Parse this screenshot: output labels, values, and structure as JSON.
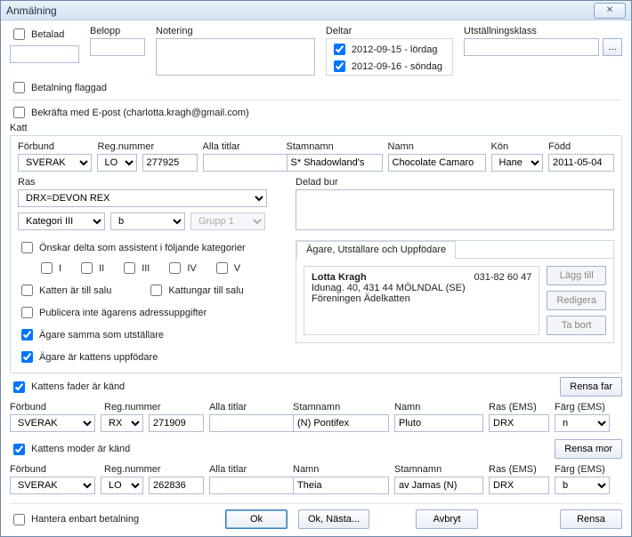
{
  "window": {
    "title": "Anmälning"
  },
  "top": {
    "betalad_label": "Betalad",
    "belopp_label": "Belopp",
    "notering_label": "Notering",
    "deltar_label": "Deltar",
    "utstallningsklass_label": "Utställningsklass",
    "betalning_flaggad_label": "Betalning flaggad",
    "deltar_items": [
      {
        "label": "2012-09-15 - lördag"
      },
      {
        "label": "2012-09-16 - söndag"
      }
    ],
    "utstallningsklass_value": ""
  },
  "confirm": {
    "label": "Bekräfta med E-post (charlotta.kragh@gmail.com)"
  },
  "katt": {
    "legend": "Katt",
    "forbund_label": "Förbund",
    "forbund_value": "SVERAK",
    "regprefix_value": "LO",
    "regnummer_label": "Reg.nummer",
    "regnummer_value": "277925",
    "alla_titlar_label": "Alla titlar",
    "alla_titlar_value": "",
    "stamnamn_label": "Stamnamn",
    "stamnamn_value": "S* Shadowland's",
    "namn_label": "Namn",
    "namn_value": "Chocolate Camaro",
    "kon_label": "Kön",
    "kon_value": "Hane",
    "fodd_label": "Född",
    "fodd_value": "2011-05-04",
    "ras_label": "Ras",
    "ras_value": "DRX=DEVON REX",
    "kategori_value": "Kategori III",
    "farg_value": "b",
    "grupp_value": "Grupp 1",
    "delad_bur_label": "Delad bur",
    "delad_bur_value": "",
    "assist_label": "Önskar delta som assistent i följande kategorier",
    "assist_I": "I",
    "assist_II": "II",
    "assist_III": "III",
    "assist_IV": "IV",
    "assist_V": "V",
    "till_salu_label": "Katten är till salu",
    "kattungar_till_salu_label": "Kattungar till salu",
    "publicera_label": "Publicera inte ägarens adressuppgifter",
    "agare_samma_label": "Ägare samma som utställare",
    "agare_uppfodare_label": "Ägare är kattens uppfödare"
  },
  "owners_tab": {
    "tab_label": "Ägare, Utställare och Uppfödare",
    "name": "Lotta Kragh",
    "phone": "031-82 60 47",
    "addr": "Idunag. 40, 431 44 MÖLNDAL (SE)",
    "org": "Föreningen Ädelkatten",
    "btn_add": "Lägg till",
    "btn_edit": "Redigera",
    "btn_del": "Ta bort"
  },
  "father": {
    "known_label": "Kattens fader är känd",
    "rensa_label": "Rensa far",
    "forbund_label": "Förbund",
    "forbund_value": "SVERAK",
    "regprefix_value": "RX",
    "regnummer_label": "Reg.nummer",
    "regnummer_value": "271909",
    "alla_titlar_label": "Alla titlar",
    "alla_titlar_value": "",
    "stamnamn_label": "Stamnamn",
    "stamnamn_value": "(N) Pontifex",
    "namn_label": "Namn",
    "namn_value": "Pluto",
    "ras_label": "Ras (EMS)",
    "ras_value": "DRX",
    "farg_label": "Färg (EMS)",
    "farg_value": "n"
  },
  "mother": {
    "known_label": "Kattens moder är känd",
    "rensa_label": "Rensa mor",
    "forbund_label": "Förbund",
    "forbund_value": "SVERAK",
    "regprefix_value": "LO",
    "regnummer_label": "Reg.nummer",
    "regnummer_value": "262836",
    "alla_titlar_label": "Alla titlar",
    "alla_titlar_value": "",
    "namn_label": "Namn",
    "namn_value": "Theia",
    "stamnamn_label": "Stamnamn",
    "stamnamn_value": "av Jamas (N)",
    "ras_label": "Ras (EMS)",
    "ras_value": "DRX",
    "farg_label": "Färg (EMS)",
    "farg_value": "b"
  },
  "footer": {
    "hantera_label": "Hantera enbart betalning",
    "ok": "Ok",
    "ok_next": "Ok, Nästa...",
    "avbryt": "Avbryt",
    "rensa": "Rensa"
  }
}
